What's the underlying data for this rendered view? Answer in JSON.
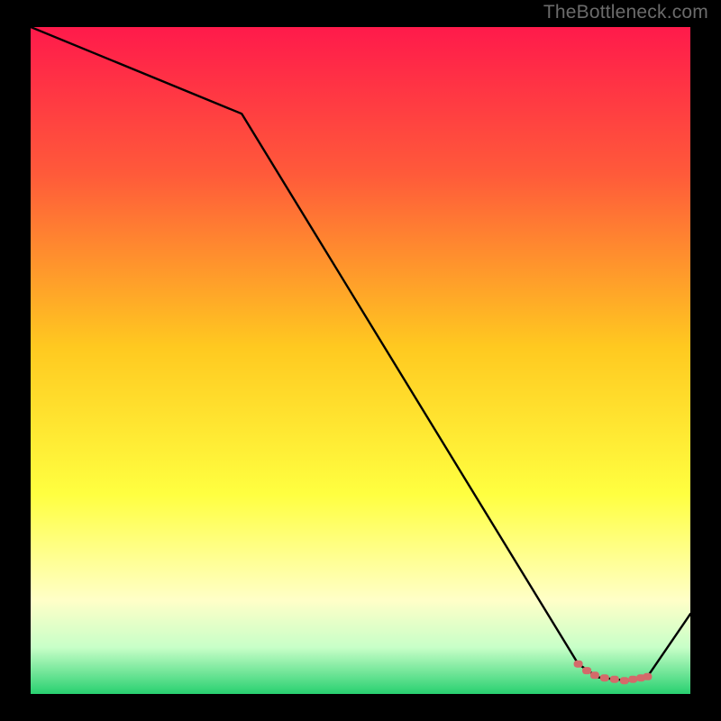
{
  "watermark": "TheBottleneck.com",
  "colors": {
    "gradient_top": "#ff1a4b",
    "gradient_upper": "#ff5a3a",
    "gradient_mid": "#ffc920",
    "gradient_lower_mid": "#ffff40",
    "gradient_pale": "#ffffc8",
    "gradient_green_pale": "#c8ffc8",
    "gradient_green": "#28d070",
    "line": "#000000",
    "marker_fill": "#d46a6a",
    "marker_stroke": "#c55a5a"
  },
  "chart_data": {
    "type": "line",
    "title": "",
    "xlabel": "",
    "ylabel": "",
    "xlim": [
      0,
      100
    ],
    "ylim": [
      0,
      100
    ],
    "series": [
      {
        "name": "curve",
        "x": [
          0,
          32,
          83,
          86,
          88.5,
          90.5,
          92,
          93.5,
          100
        ],
        "values": [
          100,
          87,
          4.5,
          2.5,
          2.2,
          2.0,
          2.2,
          2.6,
          12
        ]
      }
    ],
    "markers": {
      "name": "highlight-segment",
      "x": [
        83,
        84.3,
        85.5,
        87,
        88.5,
        90,
        91.3,
        92.5,
        93.5
      ],
      "values": [
        4.5,
        3.5,
        2.8,
        2.4,
        2.2,
        2.0,
        2.2,
        2.4,
        2.6
      ]
    }
  }
}
